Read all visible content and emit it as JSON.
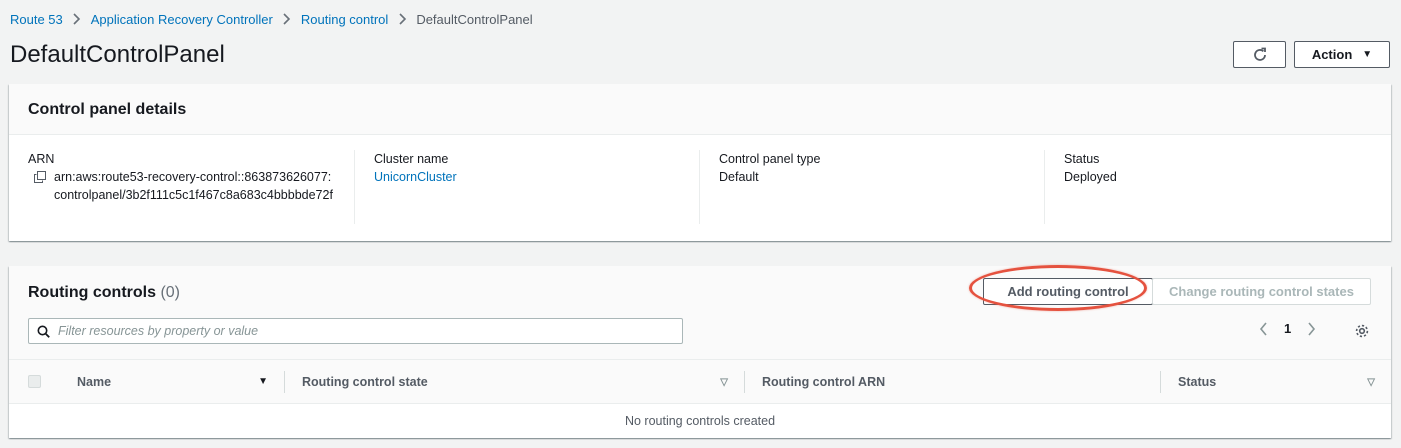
{
  "breadcrumbs": [
    "Route 53",
    "Application Recovery Controller",
    "Routing control"
  ],
  "breadcrumb_current": "DefaultControlPanel",
  "page": {
    "title": "DefaultControlPanel",
    "action_label": "Action"
  },
  "details": {
    "heading": "Control panel details",
    "arn_label": "ARN",
    "arn_value": "arn:aws:route53-recovery-control::863873626077:controlpanel/3b2f111c5c1f467c8a683c4bbbbde72f",
    "cluster_label": "Cluster name",
    "cluster_value": "UnicornCluster",
    "type_label": "Control panel type",
    "type_value": "Default",
    "status_label": "Status",
    "status_value": "Deployed"
  },
  "routing": {
    "title": "Routing controls",
    "count": "(0)",
    "add_label": "Add routing control",
    "change_label": "Change routing control states",
    "filter_placeholder": "Filter resources by property or value",
    "page_number": "1",
    "columns": [
      "Name",
      "Routing control state",
      "Routing control ARN",
      "Status"
    ],
    "empty_text": "No routing controls created"
  },
  "colors": {
    "link": "#0073bb",
    "highlight": "#e5523f",
    "background": "#f2f3f3"
  }
}
